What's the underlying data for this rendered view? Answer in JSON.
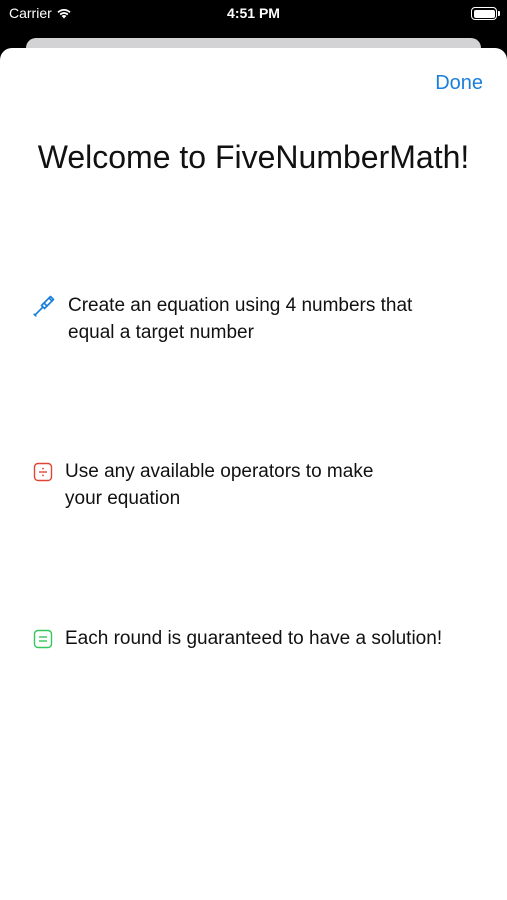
{
  "status_bar": {
    "carrier": "Carrier",
    "time": "4:51 PM"
  },
  "sheet": {
    "done_label": "Done",
    "title": "Welcome to FiveNumberMath!",
    "rows": [
      {
        "icon": "hammer-icon",
        "color": "#1a7fd9",
        "text_line1": "Create an equation using 4 numbers that",
        "text_line2": "equal a target number"
      },
      {
        "icon": "divide-square-icon",
        "color": "#e0453a",
        "text_line1": "Use any available operators to make",
        "text_line2": "your equation"
      },
      {
        "icon": "equal-square-icon",
        "color": "#34c759",
        "text_line1": "Each round is guaranteed to have a solution!"
      }
    ]
  },
  "colors": {
    "accent": "#1a7fd9",
    "status_bar_bg": "#000000",
    "sheet_bg": "#ffffff"
  }
}
